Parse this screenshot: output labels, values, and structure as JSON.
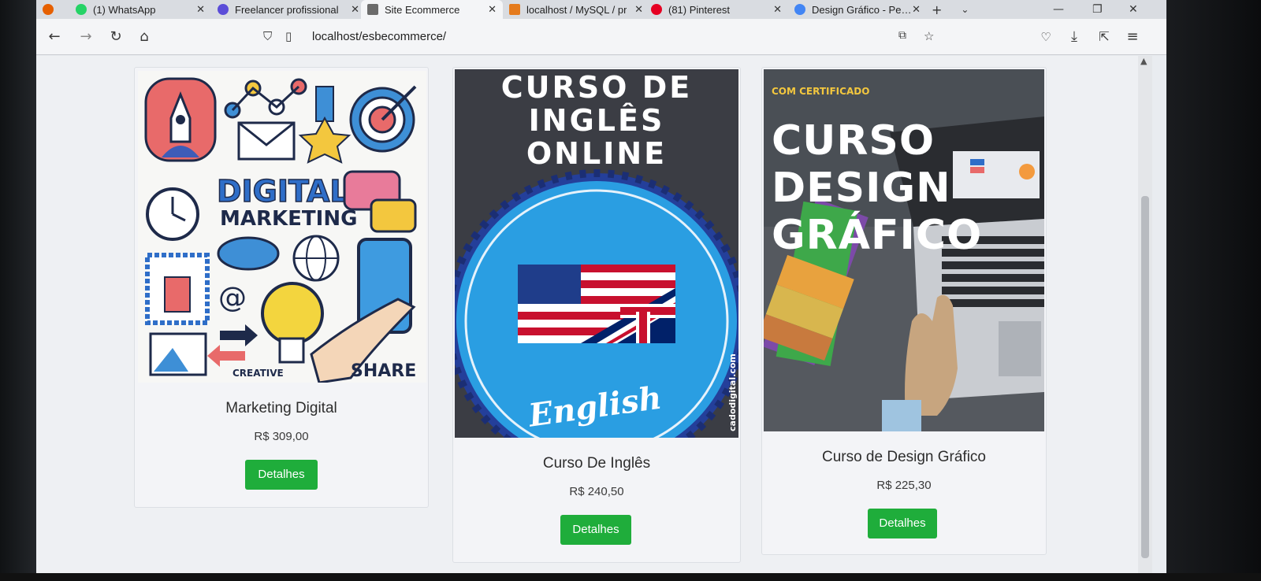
{
  "browser": {
    "tabs": [
      {
        "label": "(1) WhatsApp",
        "active": false,
        "color": "#25d366"
      },
      {
        "label": "Freelancer profissional",
        "active": false,
        "color": "#5b4dd8"
      },
      {
        "label": "Site Ecommerce",
        "active": true,
        "color": "#6b6b6b"
      },
      {
        "label": "localhost / MySQL / pr",
        "active": false,
        "color": "#e57b1d"
      },
      {
        "label": "(81) Pinterest",
        "active": false,
        "color": "#e60023"
      },
      {
        "label": "Design Gráfico - Pesqu",
        "active": false,
        "color": "#4285f4"
      }
    ],
    "url": "localhost/esbecommerce/"
  },
  "products": [
    {
      "title": "Marketing Digital",
      "price": "R$ 309,00",
      "button": "Detalhes",
      "image": {
        "words": [
          "DIGITAL",
          "MARKETING",
          "CREATIVE",
          "SHARE"
        ]
      }
    },
    {
      "title": "Curso De Inglês",
      "price": "R$ 240,50",
      "button": "Detalhes",
      "image": {
        "lines": [
          "CURSO DE",
          "INGLÊS",
          "ONLINE"
        ],
        "script": "English",
        "side": "cadodigital.com"
      }
    },
    {
      "title": "Curso de Design Gráfico",
      "price": "R$ 225,30",
      "button": "Detalhes",
      "image": {
        "badge": "COM CERTIFICADO",
        "lines": [
          "CURSO",
          "DESIGN",
          "GRÁFICO"
        ]
      }
    }
  ],
  "colors": {
    "button": "#1fad3b",
    "english_bg": "#3b3d44",
    "english_circle": "#2a9ee2",
    "design_bg": "#4a4f55"
  }
}
